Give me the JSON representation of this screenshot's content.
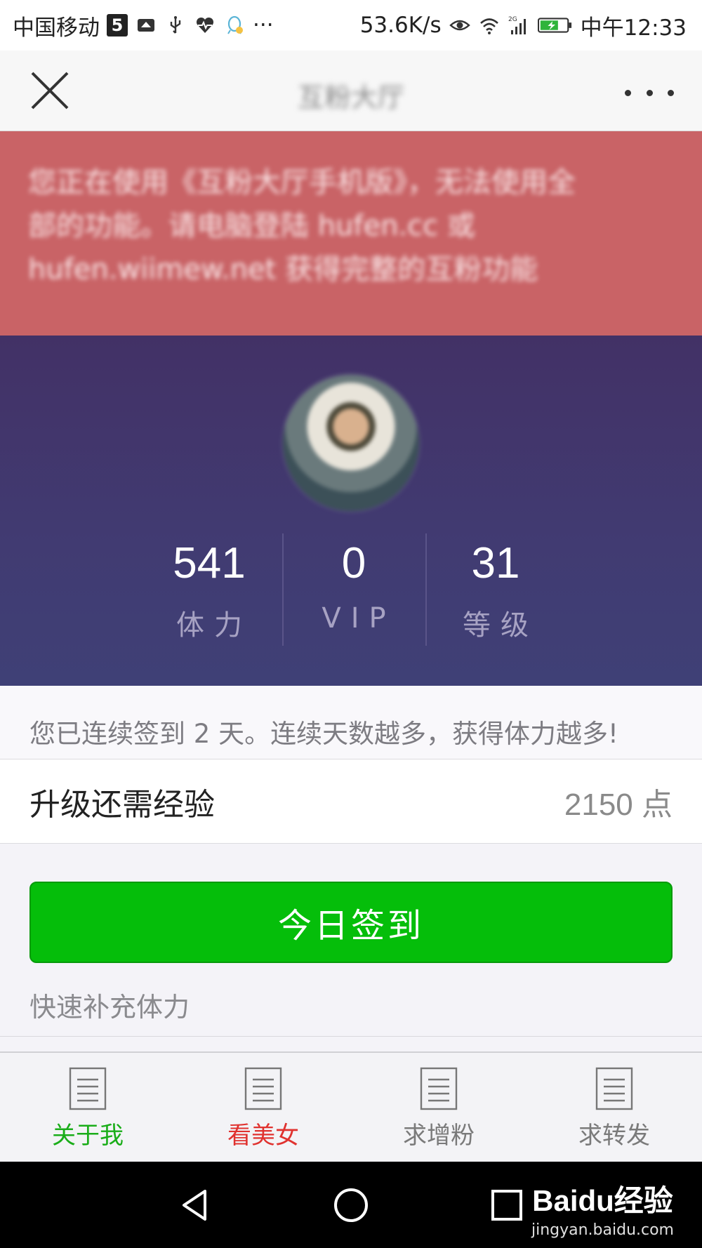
{
  "status_bar": {
    "carrier": "中国移动",
    "badge": "5",
    "more": "···",
    "speed": "53.6K/s",
    "network": "2G",
    "time": "中午12:33"
  },
  "header": {
    "title": "互粉大厅"
  },
  "notice": {
    "text_line1": "您正在使用《互粉大厅手机版》，无法使用全",
    "text_line2": "部的功能。请电脑登陆 hufen.cc 或",
    "text_line3": "hufen.wiimew.net 获得完整的互粉功能"
  },
  "profile": {
    "stats": [
      {
        "value": "541",
        "label": "体力"
      },
      {
        "value": "0",
        "label": "VIP"
      },
      {
        "value": "31",
        "label": "等级"
      }
    ]
  },
  "signin_note": "您已连续签到 2 天。连续天数越多，获得体力越多!",
  "upgrade": {
    "label": "升级还需经验",
    "value": "2150 点"
  },
  "checkin_button": "今日签到",
  "quick_link": "快速补充体力",
  "tabs": [
    {
      "label": "关于我",
      "color": "#1aad19"
    },
    {
      "label": "看美女",
      "color": "#e0322f"
    },
    {
      "label": "求增粉",
      "color": "#7a7a7a"
    },
    {
      "label": "求转发",
      "color": "#7a7a7a"
    }
  ],
  "watermark": {
    "main": "Baidu经验",
    "sub": "jingyan.baidu.com"
  },
  "colors": {
    "notice_bg": "#c96366",
    "profile_bg": "#413b72",
    "checkin_green": "#05be0a",
    "active_tab": "#1aad19"
  }
}
